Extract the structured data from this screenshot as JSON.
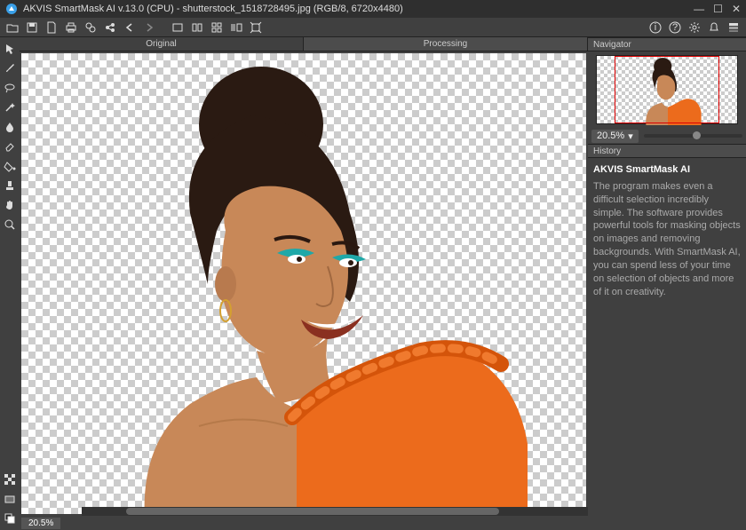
{
  "titlebar": {
    "title": "AKVIS SmartMask AI v.13.0 (CPU) - shutterstock_1518728495.jpg (RGB/8, 6720x4480)"
  },
  "toolbar": {
    "items": [
      "open",
      "save",
      "document",
      "print",
      "batch",
      "share",
      "undo",
      "redo",
      "view1",
      "view2",
      "view3",
      "compare",
      "fit"
    ],
    "right": [
      "info",
      "help",
      "settings",
      "notify",
      "panels"
    ]
  },
  "sidebar": {
    "tools": [
      "arrow",
      "brush",
      "lasso",
      "magic-wand",
      "drop",
      "eraser",
      "bucket",
      "stamp",
      "hand",
      "zoom"
    ]
  },
  "tabs": {
    "original": "Original",
    "processing": "Processing"
  },
  "statusbar": {
    "zoom": "20.5%"
  },
  "navigator": {
    "label": "Navigator",
    "zoom": "20.5%"
  },
  "history": {
    "label": "History",
    "title": "AKVIS SmartMask AI",
    "body": "The program makes even a difficult selection incredibly simple. The software provides powerful tools for masking objects on images and removing backgrounds. With SmartMask AI, you can spend less of your time on selection of objects and more of it on creativity."
  }
}
